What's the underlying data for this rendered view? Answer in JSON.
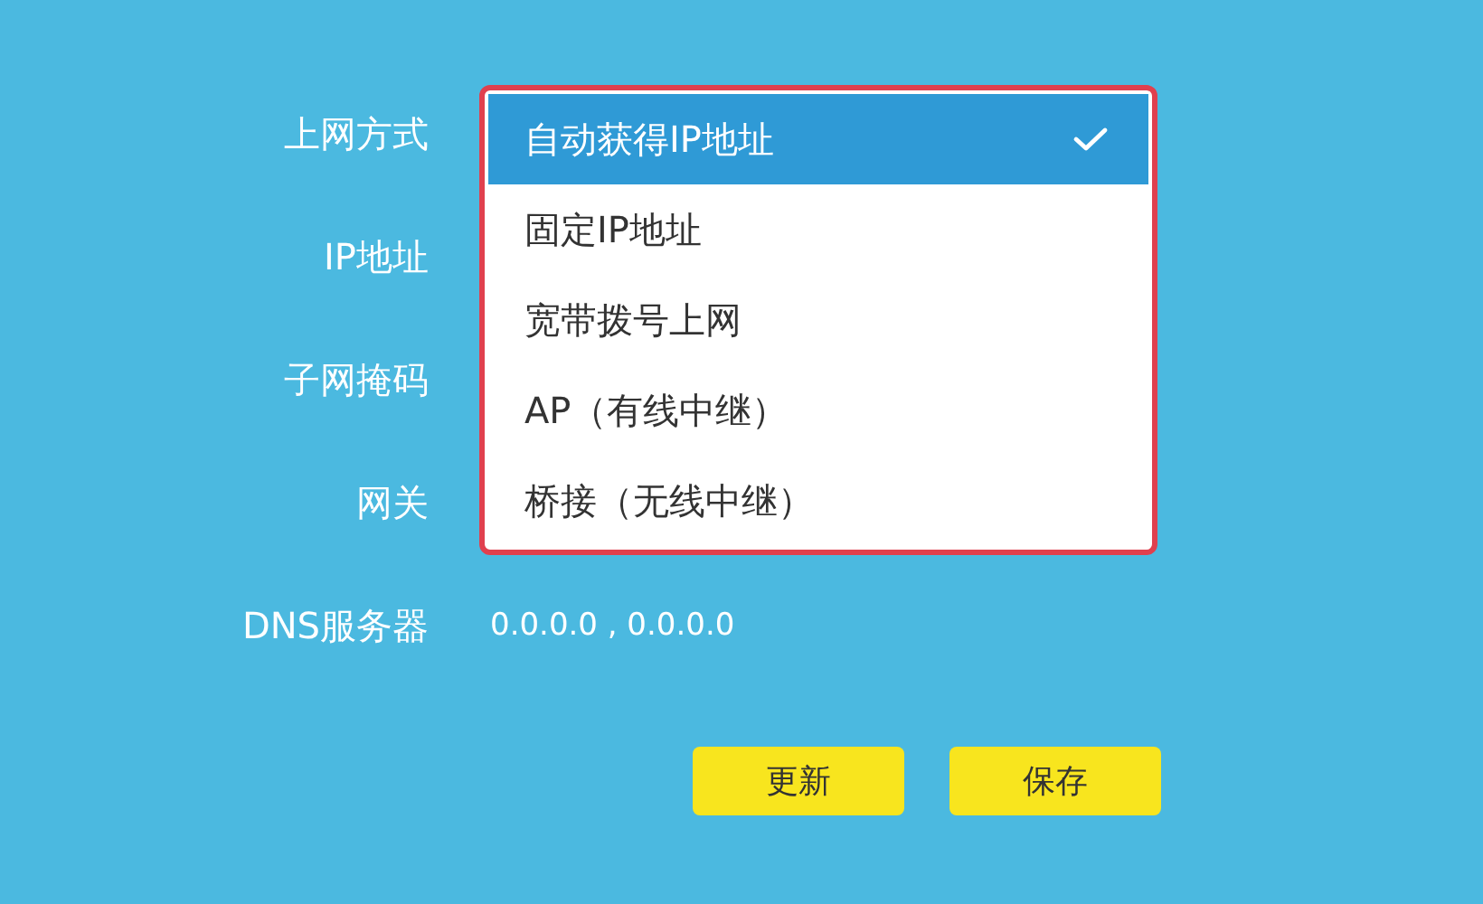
{
  "fields": [
    {
      "label": "上网方式"
    },
    {
      "label": "IP地址"
    },
    {
      "label": "子网掩码"
    },
    {
      "label": "网关"
    },
    {
      "label": "DNS服务器",
      "value": "0.0.0.0 , 0.0.0.0"
    }
  ],
  "dropdown": {
    "options": [
      {
        "label": "自动获得IP地址",
        "selected": true
      },
      {
        "label": "固定IP地址",
        "selected": false
      },
      {
        "label": "宽带拨号上网",
        "selected": false
      },
      {
        "label": "AP（有线中继）",
        "selected": false
      },
      {
        "label": "桥接（无线中继）",
        "selected": false
      }
    ]
  },
  "buttons": [
    "更新",
    "保存"
  ]
}
